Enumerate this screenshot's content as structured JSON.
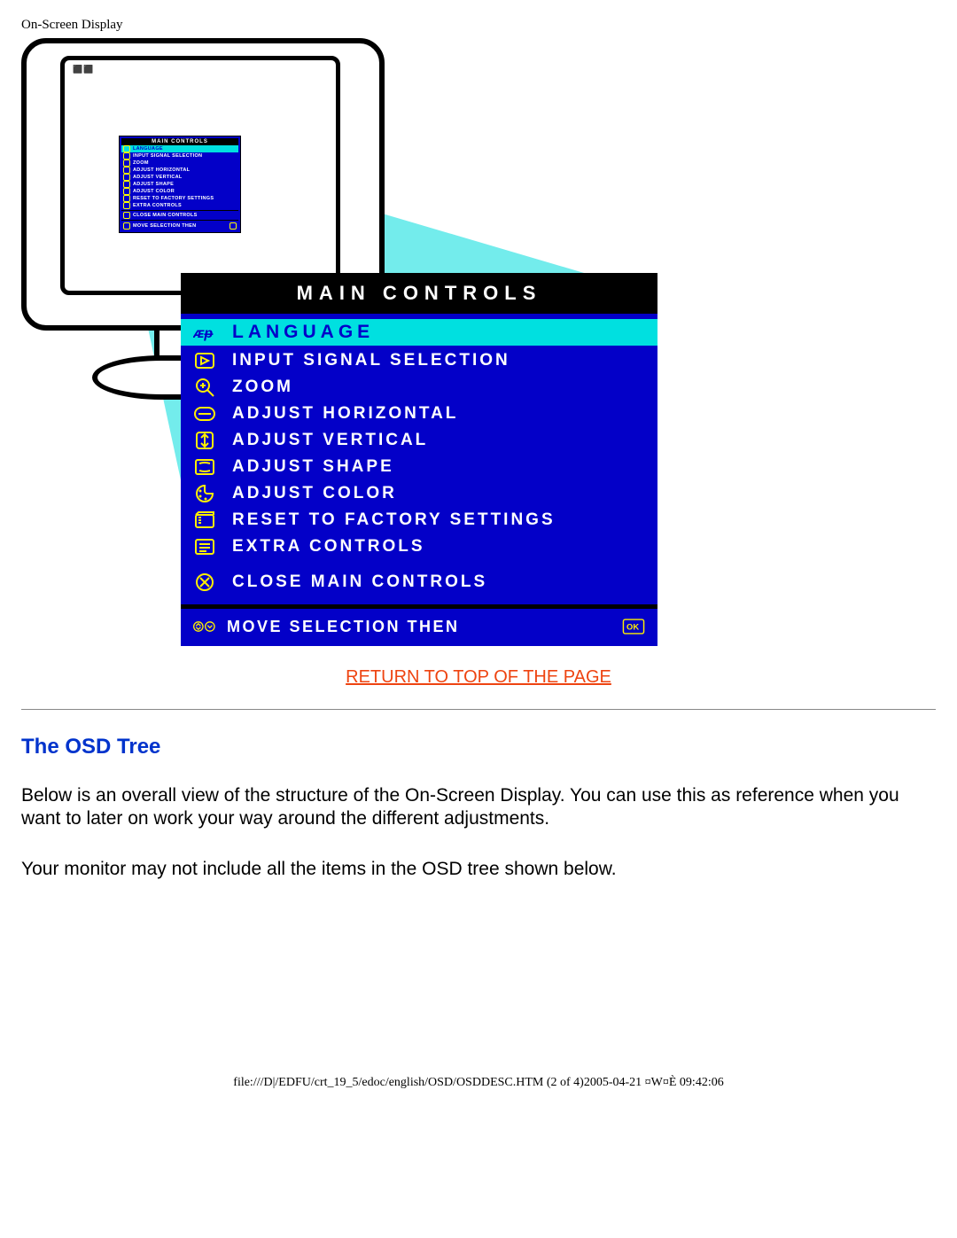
{
  "header": {
    "title": "On-Screen Display"
  },
  "osd": {
    "heading": "MAIN CONTROLS",
    "items": [
      {
        "label": "LANGUAGE",
        "icon": "language-icon",
        "highlighted": true
      },
      {
        "label": "INPUT SIGNAL SELECTION",
        "icon": "input-icon"
      },
      {
        "label": "ZOOM",
        "icon": "zoom-icon"
      },
      {
        "label": "ADJUST HORIZONTAL",
        "icon": "horiz-icon"
      },
      {
        "label": "ADJUST VERTICAL",
        "icon": "vert-icon"
      },
      {
        "label": "ADJUST SHAPE",
        "icon": "shape-icon"
      },
      {
        "label": "ADJUST COLOR",
        "icon": "color-icon"
      },
      {
        "label": "RESET TO FACTORY SETTINGS",
        "icon": "reset-icon"
      },
      {
        "label": "EXTRA CONTROLS",
        "icon": "extra-icon"
      }
    ],
    "close": {
      "label": "CLOSE MAIN CONTROLS",
      "icon": "close-icon"
    },
    "footer": {
      "label": "MOVE SELECTION THEN",
      "nav_icon": "nav-updown-icon",
      "ok_icon": "ok-icon"
    }
  },
  "link": {
    "return_top": "RETURN TO TOP OF THE PAGE"
  },
  "section": {
    "heading": "The OSD Tree",
    "para1": "Below is an overall view of the structure of the On-Screen Display. You can use this as reference when you want to later on work your way around the different adjustments.",
    "para2": "Your monitor may not include all the items in the OSD tree shown below."
  },
  "footer_path": "file:///D|/EDFU/crt_19_5/edoc/english/OSD/OSDDESC.HTM (2 of 4)2005-04-21 ¤W¤È 09:42:06"
}
